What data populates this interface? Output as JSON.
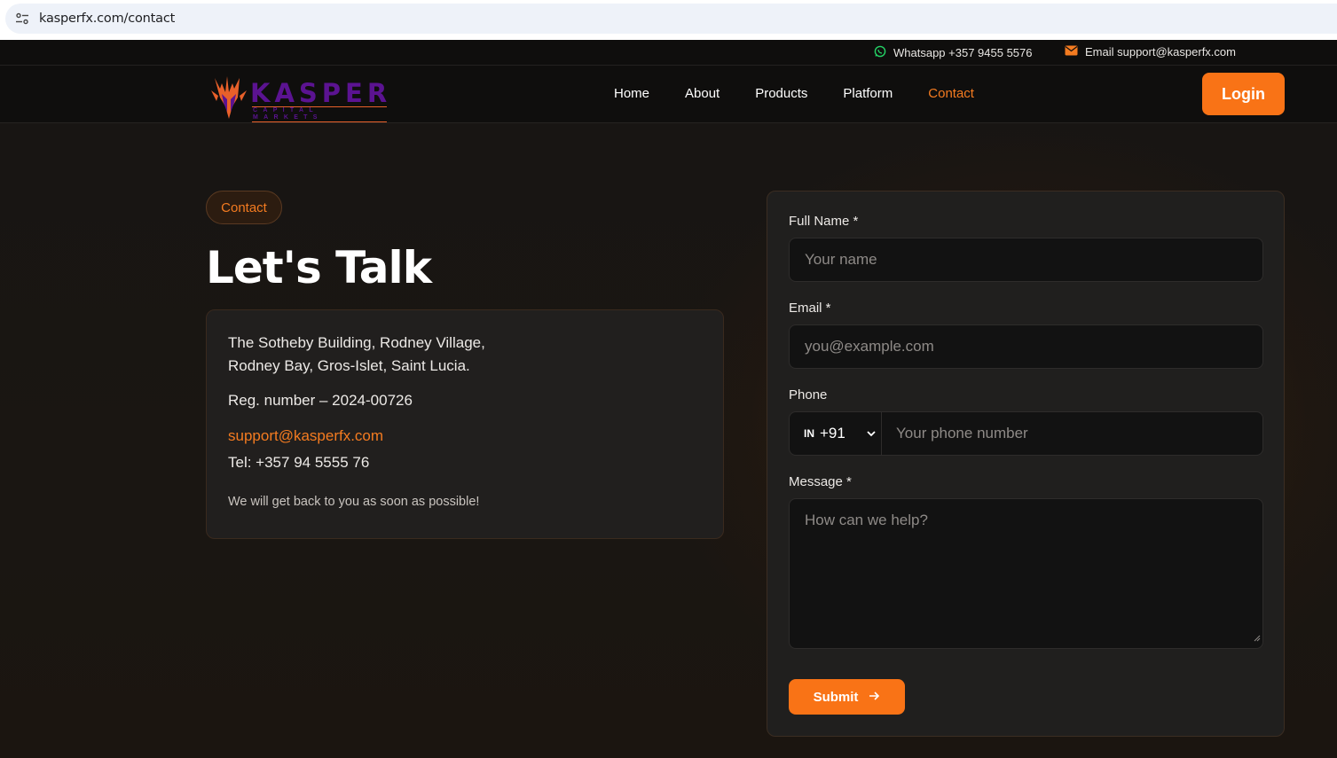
{
  "browser": {
    "url": "kasperfx.com/contact",
    "site_icon": "tune-icon"
  },
  "topbar": {
    "whatsapp_icon": "whatsapp-icon",
    "whatsapp_text": "Whatsapp +357 9455 5576",
    "email_icon": "envelope-icon",
    "email_text": "Email support@kasperfx.com"
  },
  "logo": {
    "word": "KASPER",
    "sub": "CAPITAL MARKETS"
  },
  "nav": {
    "items": [
      {
        "label": "Home",
        "active": false
      },
      {
        "label": "About",
        "active": false
      },
      {
        "label": "Products",
        "active": false
      },
      {
        "label": "Platform",
        "active": false
      },
      {
        "label": "Contact",
        "active": true
      }
    ],
    "login": "Login"
  },
  "hero": {
    "pill": "Contact",
    "title": "Let's Talk"
  },
  "info": {
    "address_line1": "The Sotheby Building, Rodney Village,",
    "address_line2": "Rodney Bay, Gros-Islet, Saint Lucia.",
    "reg": "Reg. number – 2024-00726",
    "email": "support@kasperfx.com",
    "tel": "Tel: +357 94 5555 76",
    "note": "We will get back to you as soon as possible!"
  },
  "form": {
    "name_label": "Full Name *",
    "name_placeholder": "Your name",
    "email_label": "Email *",
    "email_placeholder": "you@example.com",
    "phone_label": "Phone",
    "country_code": "IN",
    "dial_code": "+91",
    "phone_placeholder": "Your phone number",
    "message_label": "Message *",
    "message_placeholder": "How can we help?",
    "submit": "Submit"
  },
  "colors": {
    "accent": "#f97316",
    "brand_purple": "#5b1391"
  }
}
